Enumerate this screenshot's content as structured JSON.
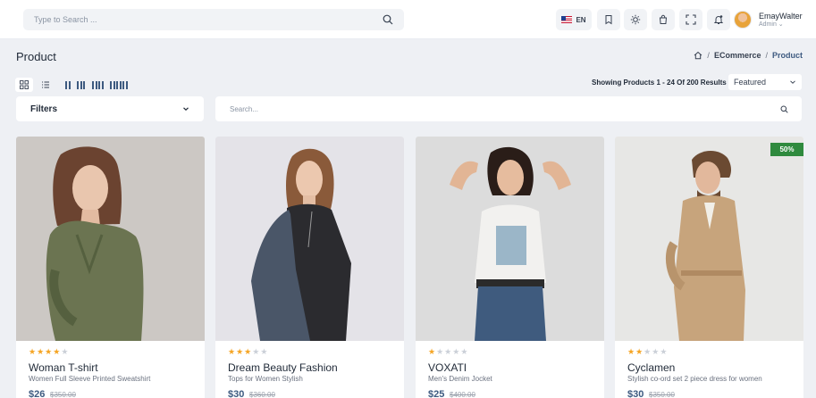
{
  "header": {
    "search_placeholder": "Type to Search ...",
    "language": "EN",
    "user_name": "EmayWalter",
    "user_role": "Admin ⌄"
  },
  "page": {
    "title": "Product",
    "breadcrumb": {
      "sep": "/",
      "section": "ECommerce",
      "current": "Product"
    }
  },
  "toolbar": {
    "showing": "Showing Products 1 - 24 Of 200 Results",
    "sort_value": "Featured",
    "filters_label": "Filters",
    "search_placeholder": "Search..."
  },
  "colors": {
    "accent": "#3d5a80",
    "star": "#f5a524",
    "badge": "#2f8a3e"
  },
  "products": [
    {
      "name": "Woman T-shirt",
      "desc": "Women Full Sleeve Printed Sweatshirt",
      "price": "$26",
      "old_price": "$350.00",
      "rating": 4,
      "badge": ""
    },
    {
      "name": "Dream Beauty Fashion",
      "desc": "Tops for Women Stylish",
      "price": "$30",
      "old_price": "$360.00",
      "rating": 3,
      "badge": ""
    },
    {
      "name": "VOXATI",
      "desc": "Men's Denim Jocket",
      "price": "$25",
      "old_price": "$400.00",
      "rating": 1,
      "badge": ""
    },
    {
      "name": "Cyclamen",
      "desc": "Stylish co-ord set 2 piece dress for women",
      "price": "$30",
      "old_price": "$350.00",
      "rating": 2,
      "badge": "50%"
    }
  ]
}
